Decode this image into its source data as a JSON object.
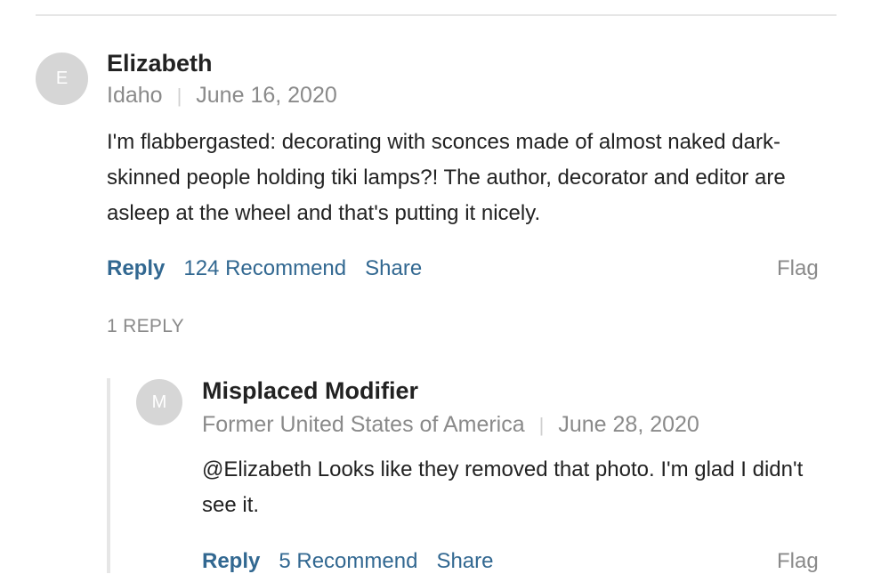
{
  "comment": {
    "avatar_letter": "E",
    "author": "Elizabeth",
    "location": "Idaho",
    "date": "June 16, 2020",
    "text": "I'm flabbergasted: decorating with sconces made of almost naked dark-skinned people holding tiki lamps?! The author, decorator and editor are asleep at the wheel and that's putting it nicely.",
    "actions": {
      "reply": "Reply",
      "recommend": "124 Recommend",
      "share": "Share",
      "flag": "Flag"
    }
  },
  "replies_label": "1 REPLY",
  "reply": {
    "avatar_letter": "M",
    "author": "Misplaced Modifier",
    "location": "Former United States of America",
    "date": "June 28, 2020",
    "text": "@Elizabeth Looks like they removed that photo. I'm glad I didn't see it.",
    "actions": {
      "reply": "Reply",
      "recommend": "5 Recommend",
      "share": "Share",
      "flag": "Flag"
    }
  },
  "colors": {
    "link": "#326891",
    "muted": "#8a8a8a",
    "avatar_bg": "#d6d6d6",
    "rule": "#e6e6e6"
  }
}
